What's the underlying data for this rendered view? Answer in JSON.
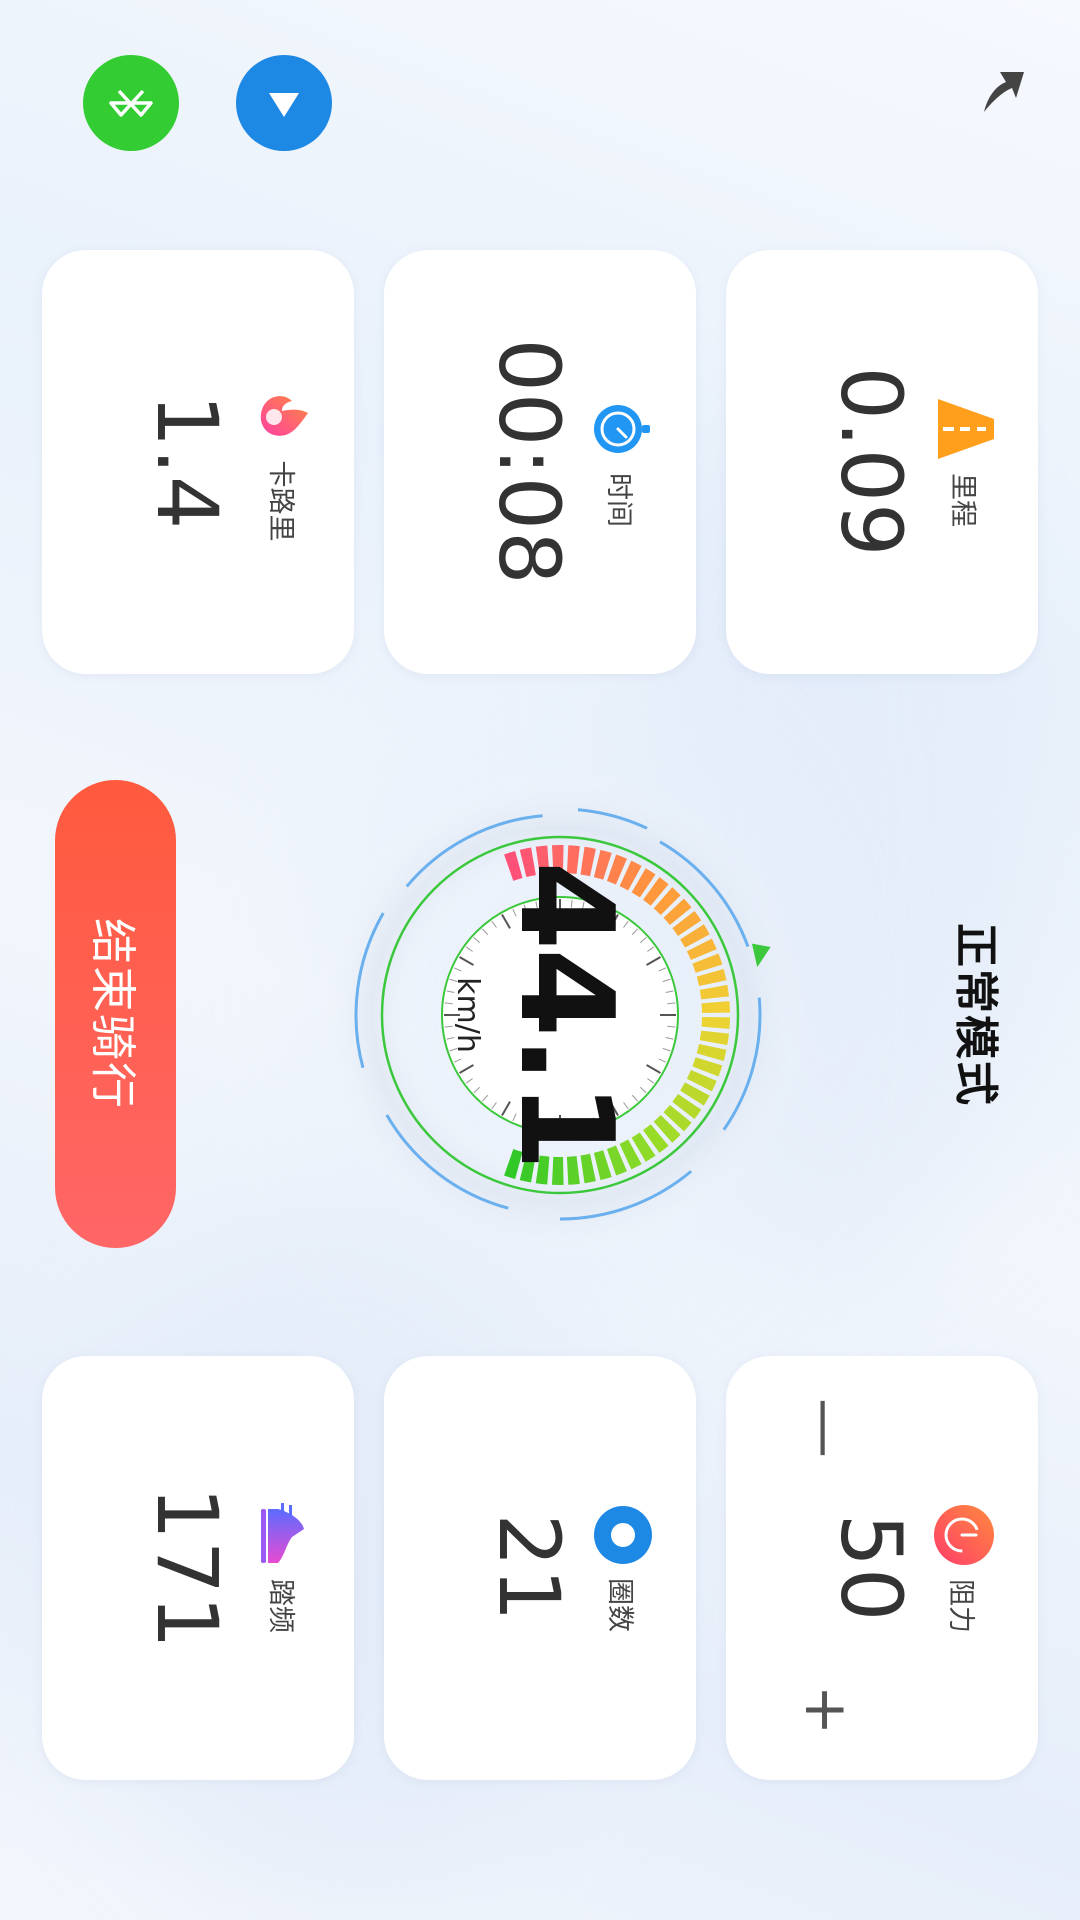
{
  "header": {
    "bluetooth_icon": "bluetooth-icon",
    "signal_icon": "signal-down-icon",
    "exit_icon": "exit-arrow-icon",
    "bluetooth_color": "#33cc33",
    "signal_color": "#1e88e5"
  },
  "stats": {
    "calories": {
      "label": "卡路里",
      "value": "1.4",
      "icon": "flame-icon"
    },
    "time": {
      "label": "时间",
      "value": "00:08",
      "icon": "stopwatch-icon"
    },
    "distance": {
      "label": "里程",
      "value": "0.09",
      "icon": "road-icon"
    },
    "cadence": {
      "label": "踏频",
      "value": "171",
      "icon": "sneaker-icon"
    },
    "laps": {
      "label": "圈数",
      "value": "21",
      "icon": "ring-icon"
    },
    "resistance": {
      "label": "阻力",
      "value": "50",
      "icon": "gauge-icon",
      "minus": "—",
      "plus": "+"
    }
  },
  "speedometer": {
    "value": "44.1",
    "unit": "km/h"
  },
  "end_button": {
    "label": "结束骑行",
    "color": "#ff5a3e"
  },
  "mode": {
    "label": "正常模式"
  }
}
